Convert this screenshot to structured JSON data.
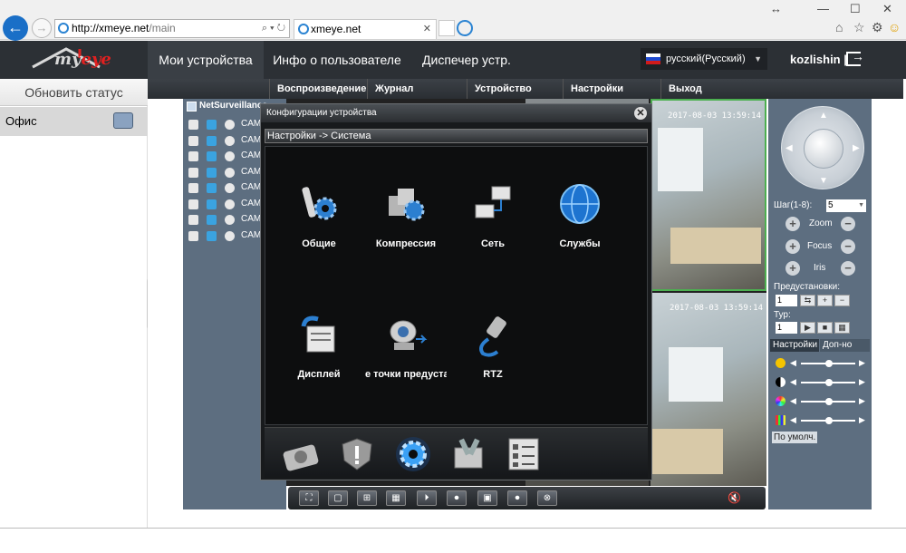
{
  "browser": {
    "url_host": "http://xmeye.net",
    "url_path": "/main",
    "tab_title": "xmeye.net",
    "addr_tools": "⌕ ▾ ↻",
    "tab_close": "✕",
    "back_glyph": "←",
    "fwd_glyph": "→",
    "ctrl_restore": "↔",
    "ctrl_min": "—",
    "ctrl_max": "☐",
    "ctrl_close": "✕",
    "tool_home": "⌂",
    "tool_fav": "☆",
    "tool_gear": "⚙",
    "tool_smile": "☺"
  },
  "header": {
    "logo": {
      "my": "my",
      "eye": "eye"
    },
    "menu": [
      "Мои устройства",
      "Инфо о пользователе",
      "Диспечер устр."
    ],
    "language": "русский(Русский)",
    "lang_caret": "▼",
    "username": "kozlishin",
    "separator": "|"
  },
  "sidebar": {
    "refresh_label": "Обновить статус",
    "group_label": "Офис",
    "collapse_glyph": "«"
  },
  "submenu": [
    "Воспроизведение",
    "Журнал",
    "Устройство",
    "Настройки",
    "Выход"
  ],
  "channels": {
    "title": "NetSurveillance",
    "items": [
      "CAM",
      "CAM",
      "CAM",
      "CAM",
      "CAM",
      "CAM",
      "CAM",
      "CAM"
    ]
  },
  "cameras": {
    "timestamp_1": "2017-08-03 13:59:14",
    "timestamp_2": "2017-08-03 13:59:14"
  },
  "ptz": {
    "arrows": {
      "up": "▲",
      "down": "▼",
      "left": "◀",
      "right": "▶"
    },
    "step_label": "Шаг(1-8):",
    "step_value": "5",
    "step_caret": "▼",
    "plus": "+",
    "minus": "−",
    "zoom": "Zoom",
    "focus": "Focus",
    "iris": "Iris",
    "presets_label": "Предустановки:",
    "preset_value": "1",
    "preset_btns": {
      "goto": "⇆",
      "add": "+",
      "remove": "−"
    },
    "tour_label": "Тур:",
    "tour_value": "1",
    "tour_btns": {
      "play": "▶",
      "stop": "■",
      "grid": "▦"
    },
    "tab_settings": "Настройки",
    "tab_extra": "Доп-но",
    "slider_left": "◀",
    "slider_right": "▶",
    "default_label": "По умолч."
  },
  "video_toolbar": {
    "buttons": [
      "⛶",
      "▢",
      "⊞",
      "▦",
      "⏵",
      "⏺",
      "▣",
      "⏺",
      "⊗"
    ],
    "mute": "🔇"
  },
  "dialog": {
    "title": "Конфигурации устройства",
    "close": "✕",
    "breadcrumb": "Настройки -> Система",
    "items": [
      "Общие",
      "Компрессия",
      "Сеть",
      "Службы",
      "Дисплей",
      "е точки предуста",
      "RTZ"
    ]
  },
  "colors": {
    "appbar": "#2c3035",
    "panel": "#5d6e80",
    "accent_blue": "#1a6fc7"
  }
}
